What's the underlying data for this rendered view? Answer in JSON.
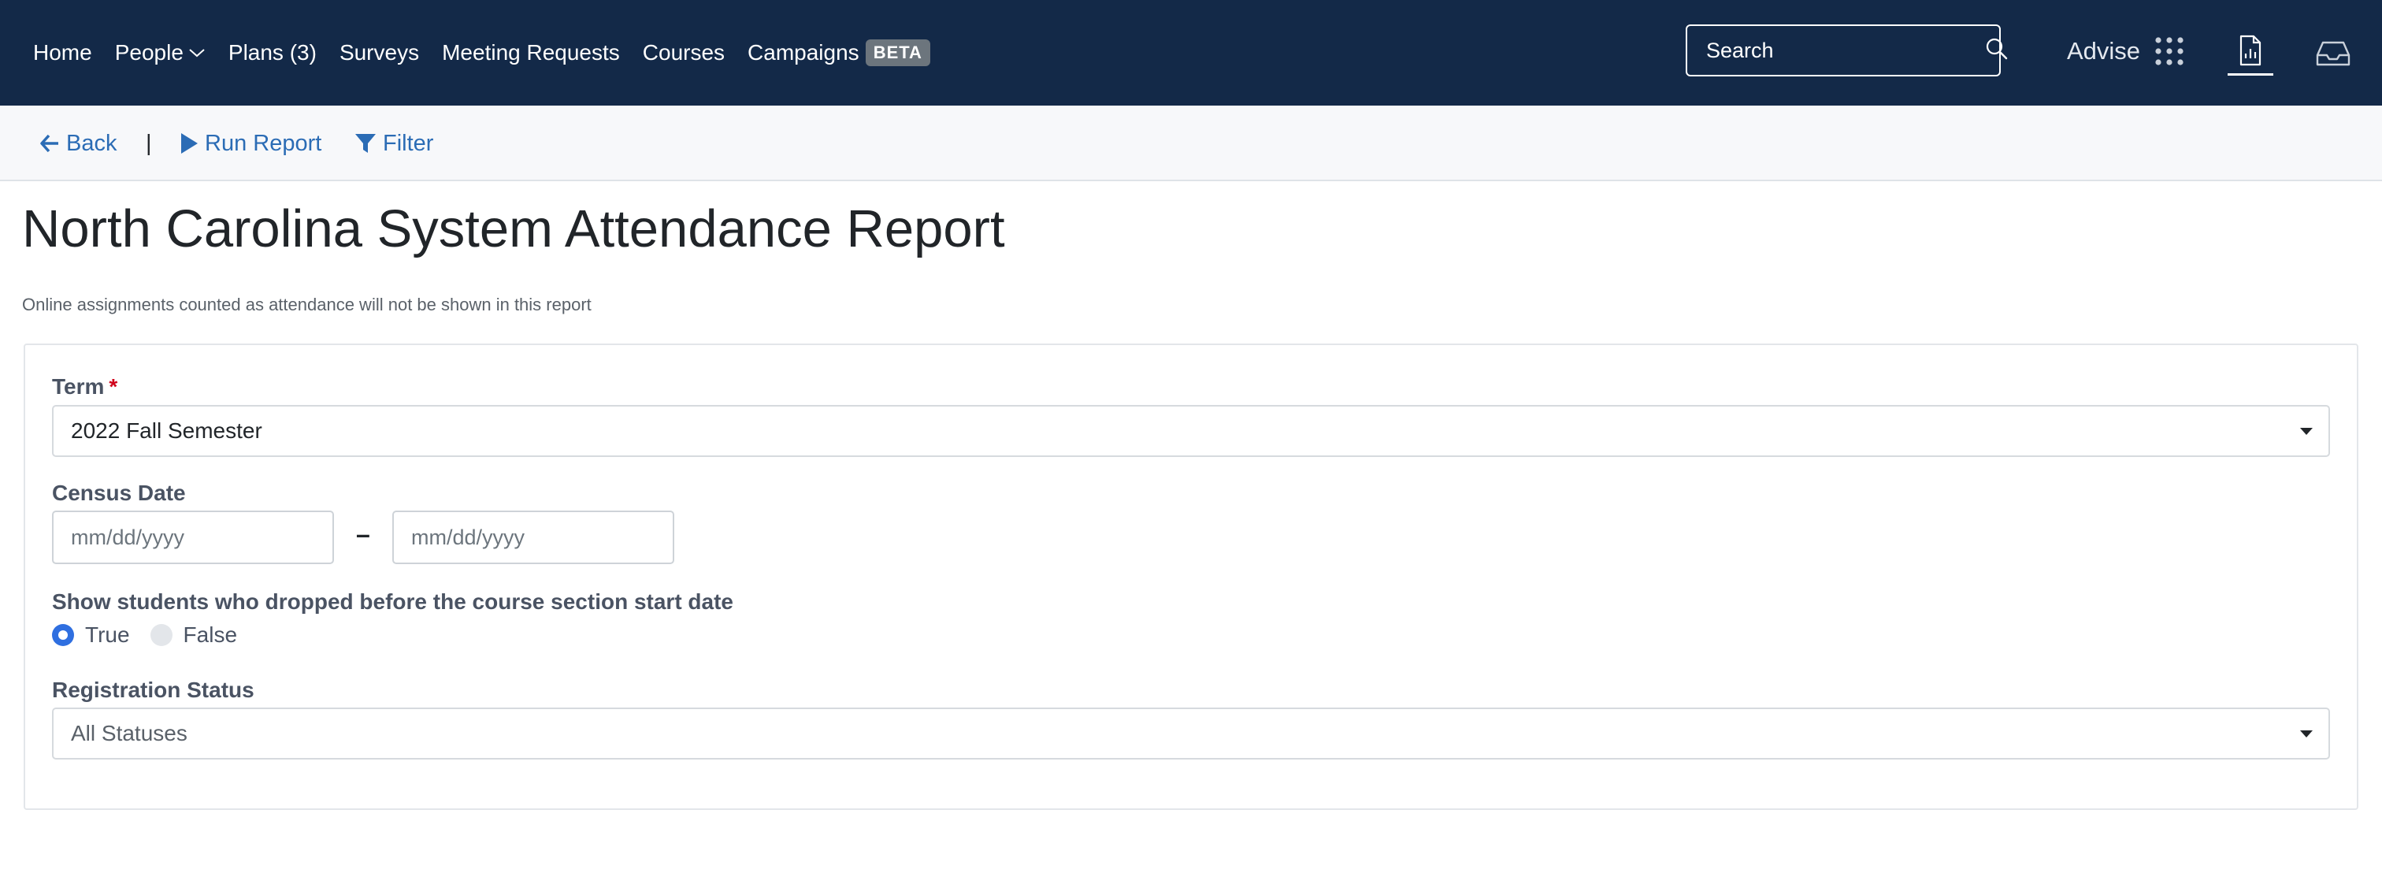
{
  "nav": {
    "items": [
      {
        "label": "Home"
      },
      {
        "label": "People"
      },
      {
        "label": "Plans (3)"
      },
      {
        "label": "Surveys"
      },
      {
        "label": "Meeting Requests"
      },
      {
        "label": "Courses"
      },
      {
        "label": "Campaigns"
      }
    ],
    "campaigns_badge": "BETA",
    "search_placeholder": "Search",
    "advise_label": "Advise",
    "icons": [
      "chevron-down-icon",
      "search-icon",
      "apps-grid-icon",
      "report-icon",
      "inbox-icon"
    ]
  },
  "toolbar": {
    "back_label": "Back",
    "separator": "|",
    "run_label": "Run Report",
    "filter_label": "Filter"
  },
  "page": {
    "title": "North Carolina System Attendance Report",
    "note": "Online assignments counted as attendance will not be shown in this report"
  },
  "form": {
    "term_label": "Term",
    "required_mark": "*",
    "term_value": "2022 Fall Semester",
    "census_label": "Census Date",
    "census_start_placeholder": "mm/dd/yyyy",
    "census_end_placeholder": "mm/dd/yyyy",
    "range_dash": "–",
    "dropped_label": "Show students who dropped before the course section start date",
    "option_true": "True",
    "option_false": "False",
    "dropped_selected": "True",
    "registration_label": "Registration Status",
    "registration_value": "All Statuses"
  },
  "colors": {
    "navbar_bg": "#132948",
    "link_blue": "#2b6cb5",
    "radio_selected": "#2f6fe0",
    "required_red": "#d0021b"
  }
}
